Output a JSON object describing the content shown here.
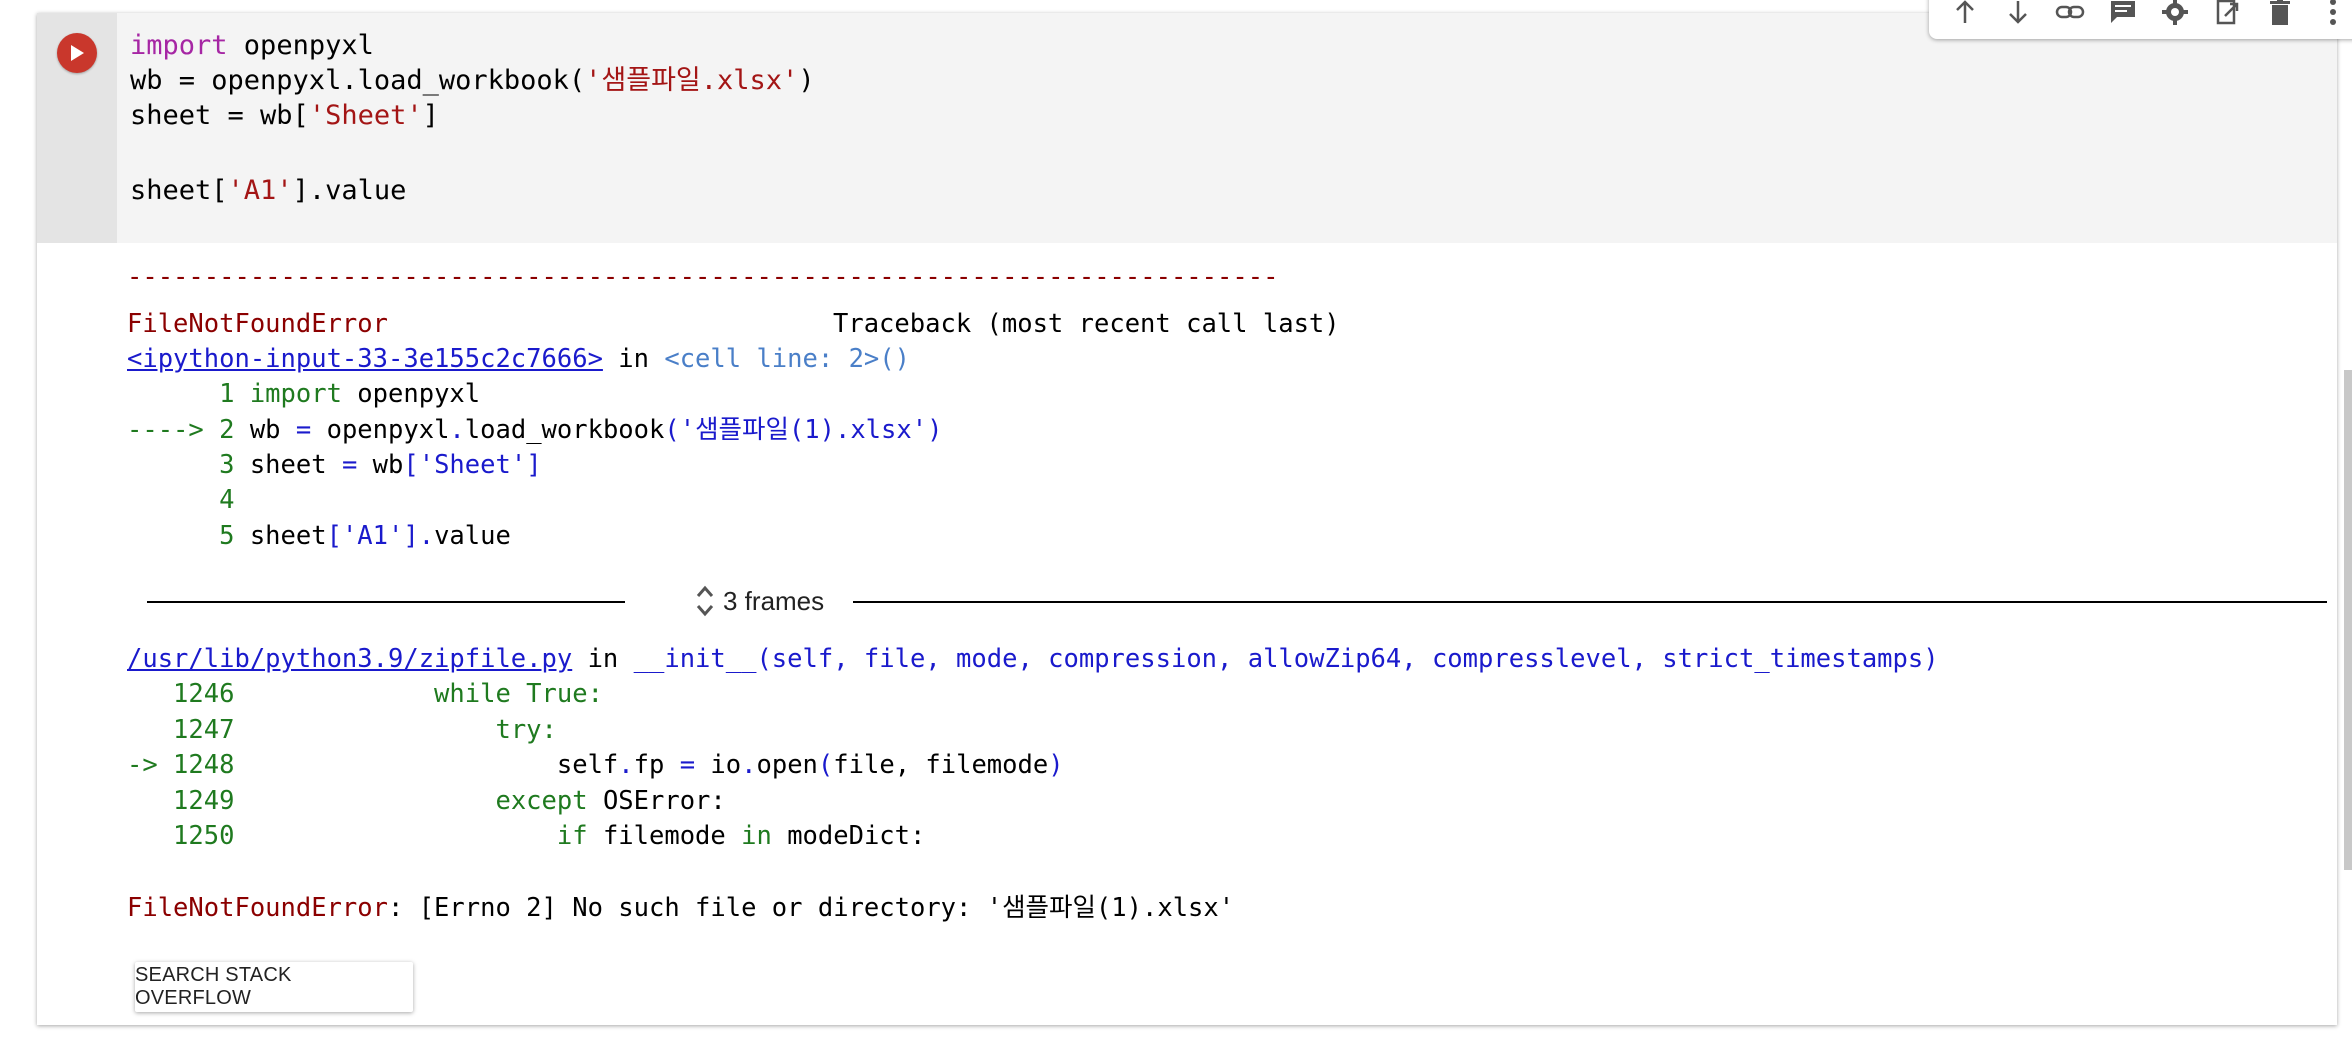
{
  "toolbar": {
    "icons": [
      "move-up-icon",
      "move-down-icon",
      "link-icon",
      "comment-icon",
      "settings-icon",
      "mirror-cell-icon",
      "delete-icon",
      "more-icon"
    ]
  },
  "code": {
    "l1_kw": "import",
    "l1_rest": " openpyxl",
    "l2_a": "wb = openpyxl.load_workbook(",
    "l2_str": "'샘플파일.xlsx'",
    "l2_b": ")",
    "l3_a": "sheet = wb[",
    "l3_str": "'Sheet'",
    "l3_b": "]",
    "l5_a": "sheet[",
    "l5_str": "'A1'",
    "l5_b": "].value"
  },
  "output": {
    "dashes": "---------------------------------------------------------------------------",
    "error_name": "FileNotFoundError",
    "traceback_header": "Traceback (most recent call last)",
    "input_link": "<ipython-input-33-3e155c2c7666>",
    "in_word": " in ",
    "cell_ref": "<cell line: 2>()",
    "tb1": {
      "n1": "      1 ",
      "t1_kw": "import",
      "t1_rest": " openpyxl",
      "arrow2": "----> 2 ",
      "t2_a": "wb ",
      "t2_eq": "=",
      "t2_b": " openpyxl",
      "t2_dot": ".",
      "t2_c": "load_workbook",
      "t2_str": "('샘플파일(1).xlsx')",
      "n3": "      3 ",
      "t3_a": "sheet ",
      "t3_eq": "=",
      "t3_b": " wb",
      "t3_str": "['Sheet']",
      "n4": "      4",
      "n5": "      5 ",
      "t5_a": "sheet",
      "t5_str": "['A1']",
      "t5_dot": ".",
      "t5_b": "value"
    },
    "frames_label": "3 frames",
    "zip_link": "/usr/lib/python3.9/zipfile.py",
    "zip_in": " in ",
    "zip_func": "__init__(self, file, mode, compression, allowZip64, compresslevel, strict_timestamps)",
    "tb2": {
      "n1246": "   1246 ",
      "k1246": "            while True:",
      "n1247": "   1247 ",
      "k1247": "                try:",
      "arrow1248": "-> 1248 ",
      "c1248_a": "                    self",
      "c1248_dot": ".",
      "c1248_b": "fp ",
      "c1248_eq": "=",
      "c1248_c": " io",
      "c1248_dot2": ".",
      "c1248_d": "open",
      "c1248_p": "(",
      "c1248_e": "file, filemode",
      "c1248_p2": ")",
      "n1249": "   1249 ",
      "k1249": "                except",
      "c1249": " OSError:",
      "n1250": "   1250 ",
      "k1250_a": "                    if",
      "c1250_a": " filemode ",
      "k1250_b": "in",
      "c1250_b": " modeDict:"
    },
    "final_error_name": "FileNotFoundError",
    "final_error_msg": ": [Errno 2] No such file or directory: '샘플파일(1).xlsx'",
    "search_button": "SEARCH STACK OVERFLOW"
  }
}
